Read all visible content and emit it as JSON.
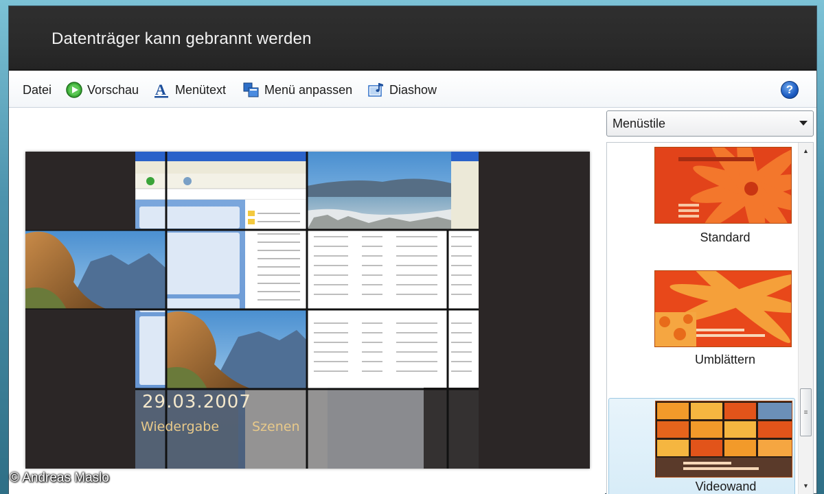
{
  "window": {
    "title": "Datenträger kann gebrannt werden"
  },
  "toolbar": {
    "file_label": "Datei",
    "preview_label": "Vorschau",
    "menutext_label": "Menütext",
    "customize_label": "Menü anpassen",
    "slideshow_label": "Diashow",
    "help_label": "?"
  },
  "preview": {
    "date_text": "29.03.2007",
    "play_label": "Wiedergabe",
    "scenes_label": "Szenen"
  },
  "sidebar": {
    "dropdown_value": "Menüstile",
    "styles": [
      {
        "label": "Standard",
        "selected": false
      },
      {
        "label": "Umblättern",
        "selected": false
      },
      {
        "label": "Videowand",
        "selected": true
      }
    ]
  },
  "watermark": "© Andreas Maslo",
  "colors": {
    "titlebar": "#2a2a2a",
    "accent_selection": "#d7ecf8",
    "menu_text": "#e8c98a",
    "flower_orange": "#f06a1c"
  }
}
